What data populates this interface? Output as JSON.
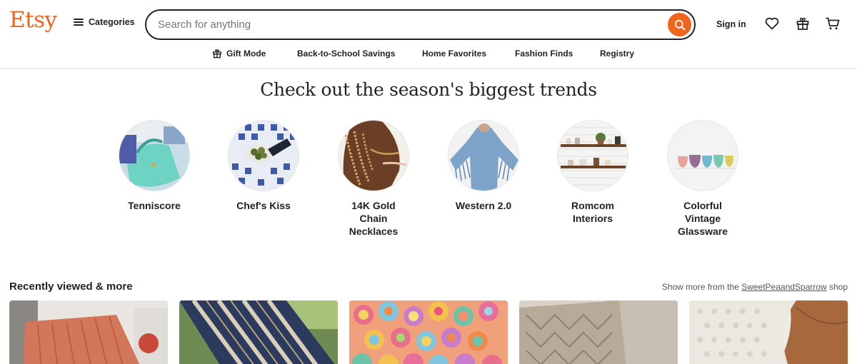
{
  "header": {
    "logo": "Etsy",
    "categories_label": "Categories",
    "search_placeholder": "Search for anything",
    "sign_in": "Sign in",
    "icons": [
      "search-icon",
      "heart-icon",
      "gift-icon",
      "cart-icon",
      "menu-icon"
    ]
  },
  "subnav": {
    "items": [
      {
        "label": "Gift Mode",
        "icon": "gift-icon"
      },
      {
        "label": "Back-to-School Savings"
      },
      {
        "label": "Home Favorites"
      },
      {
        "label": "Fashion Finds"
      },
      {
        "label": "Registry"
      }
    ]
  },
  "trends": {
    "title": "Check out the season's biggest trends",
    "items": [
      {
        "line1": "Tenniscore",
        "line2": "",
        "line3": ""
      },
      {
        "line1": "Chef's Kiss",
        "line2": "",
        "line3": ""
      },
      {
        "line1": "14K Gold",
        "line2": "Chain",
        "line3": "Necklaces"
      },
      {
        "line1": "Western 2.0",
        "line2": "",
        "line3": ""
      },
      {
        "line1": "Romcom",
        "line2": "Interiors",
        "line3": ""
      },
      {
        "line1": "Colorful",
        "line2": "Vintage",
        "line3": "Glassware"
      }
    ]
  },
  "recent": {
    "title": "Recently viewed & more",
    "show_more_prefix": "Show more from the",
    "shop_name": "SweetPeaandSparrow",
    "show_more_suffix": "shop"
  },
  "colors": {
    "brand": "#f1641e",
    "text": "#222222"
  }
}
